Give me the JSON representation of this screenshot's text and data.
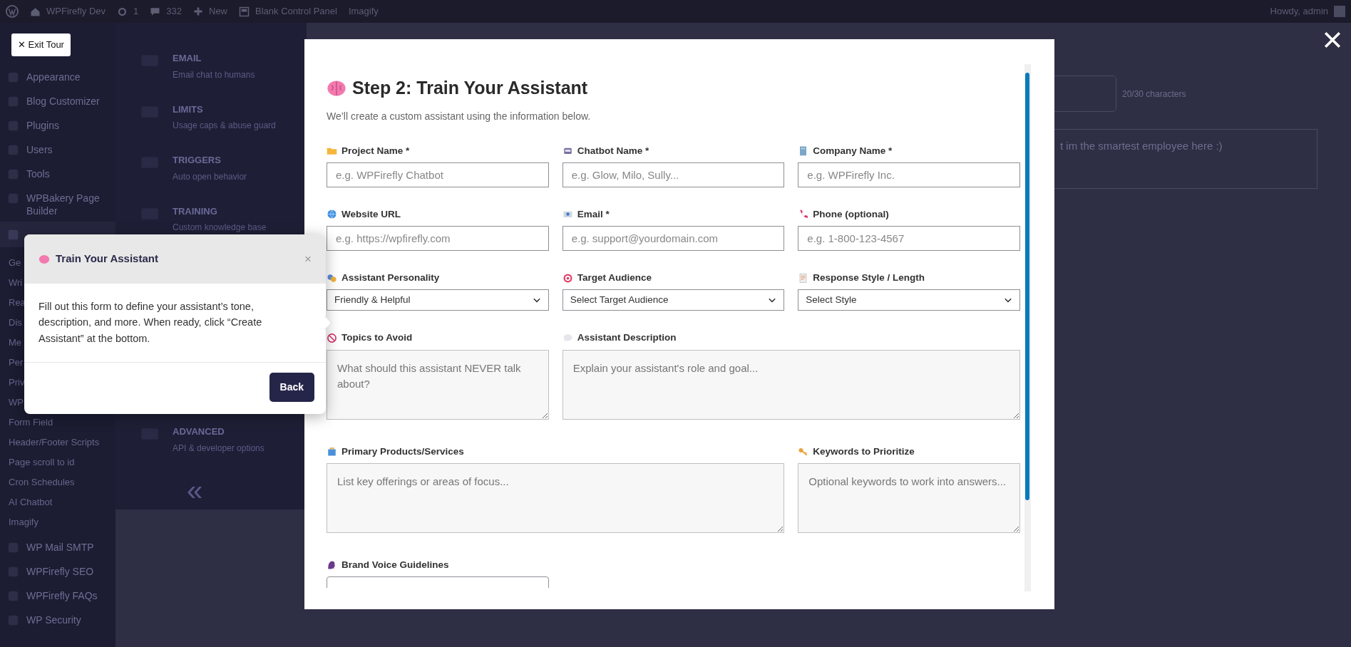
{
  "admin_bar": {
    "site": "WPFirefly Dev",
    "updates": "1",
    "comments": "332",
    "new": "New",
    "links": [
      "Blank Control Panel",
      "Imagify"
    ],
    "greeting": "Howdy, admin"
  },
  "sidebar": {
    "items": [
      {
        "kind": "menu",
        "label": "Appearance"
      },
      {
        "kind": "menu",
        "label": "Blog Customizer"
      },
      {
        "kind": "menu",
        "label": "Plugins"
      },
      {
        "kind": "menu",
        "label": "Users"
      },
      {
        "kind": "menu",
        "label": "Tools"
      },
      {
        "kind": "menu",
        "label": "WPBakery Page Builder"
      },
      {
        "kind": "current"
      },
      {
        "kind": "sub",
        "label": "Ge"
      },
      {
        "kind": "sub",
        "label": "Wri"
      },
      {
        "kind": "sub",
        "label": "Rea"
      },
      {
        "kind": "sub",
        "label": "Dis"
      },
      {
        "kind": "sub",
        "label": "Me"
      },
      {
        "kind": "sub",
        "label": "Per"
      },
      {
        "kind": "sub",
        "label": "Priv"
      },
      {
        "kind": "sub",
        "label": "WP"
      },
      {
        "kind": "sub",
        "label": "Form Field"
      },
      {
        "kind": "sub",
        "label": "Header/Footer Scripts"
      },
      {
        "kind": "sub",
        "label": "Page scroll to id"
      },
      {
        "kind": "sub",
        "label": "Cron Schedules"
      },
      {
        "kind": "sub",
        "label": "AI Chatbot"
      },
      {
        "kind": "sub",
        "label": "Imagify"
      },
      {
        "kind": "menu",
        "label": "WP Mail SMTP"
      },
      {
        "kind": "menu",
        "label": "WPFirefly SEO"
      },
      {
        "kind": "menu",
        "label": "WPFirefly FAQs"
      },
      {
        "kind": "menu",
        "label": "WP Security"
      }
    ]
  },
  "settings_nav": {
    "sections": [
      {
        "title": "EMAIL",
        "subtitle": "Email chat to humans"
      },
      {
        "title": "LIMITS",
        "subtitle": "Usage caps & abuse guard"
      },
      {
        "title": "TRIGGERS",
        "subtitle": "Auto open behavior"
      },
      {
        "title": "TRAINING",
        "subtitle": "Custom knowledge base"
      },
      {
        "title": "ADVANCED",
        "subtitle": "API & developer options"
      }
    ],
    "collapse": "«"
  },
  "background_form": {
    "counter": "20/30 characters",
    "textarea_value": "t im the smartest employee here :)"
  },
  "exit_tour": {
    "label": "✕ Exit Tour"
  },
  "modal": {
    "title": "Step 2: Train Your Assistant",
    "subtitle": "We’ll create a custom assistant using the information below.",
    "fields": [
      {
        "kind": "input",
        "label": "Project Name *",
        "placeholder": "e.g. WPFirefly Chatbot"
      },
      {
        "kind": "input",
        "label": "Chatbot Name *",
        "placeholder": "e.g. Glow, Milo, Sully..."
      },
      {
        "kind": "input",
        "label": "Company Name *",
        "placeholder": "e.g. WPFirefly Inc."
      },
      {
        "kind": "input",
        "label": "Website URL",
        "placeholder": "e.g. https://wpfirefly.com"
      },
      {
        "kind": "input",
        "label": "Email *",
        "placeholder": "e.g. support@yourdomain.com"
      },
      {
        "kind": "input",
        "label": "Phone (optional)",
        "placeholder": "e.g. 1-800-123-4567"
      },
      {
        "kind": "select",
        "label": "Assistant Personality",
        "value": "Friendly & Helpful"
      },
      {
        "kind": "select",
        "label": "Target Audience",
        "value": "Select Target Audience"
      },
      {
        "kind": "select",
        "label": "Response Style / Length",
        "value": "Select Style"
      },
      {
        "kind": "textarea",
        "label": "Topics to Avoid",
        "placeholder": "What should this assistant NEVER talk about?"
      },
      {
        "kind": "textarea",
        "label": "Assistant Description",
        "placeholder": "Explain your assistant's role and goal..."
      },
      {
        "kind": "textarea",
        "label": "Primary Products/Services",
        "placeholder": "List key offerings or areas of focus..."
      },
      {
        "kind": "textarea",
        "label": "Keywords to Prioritize",
        "placeholder": "Optional keywords to work into answers..."
      },
      {
        "kind": "textarea",
        "label": "Brand Voice Guidelines"
      }
    ]
  },
  "tour_popup": {
    "title": "Train Your Assistant",
    "body": "Fill out this form to define your assistant’s tone, description, and more. When ready, click “Create Assistant” at the bottom.",
    "close": "×",
    "back": "Back"
  }
}
